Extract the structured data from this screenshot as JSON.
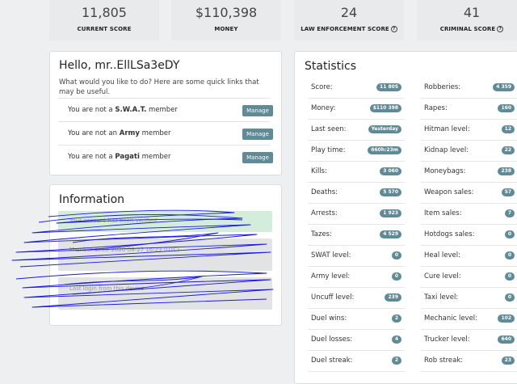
{
  "stats": [
    {
      "value": "11,805",
      "label": "CURRENT SCORE",
      "help": false
    },
    {
      "value": "$110,398",
      "label": "MONEY",
      "help": false
    },
    {
      "value": "24",
      "label": "LAW ENFORCEMENT SCORE",
      "help": true
    },
    {
      "value": "41",
      "label": "CRIMINAL SCORE",
      "help": true
    }
  ],
  "welcome": {
    "title": "Hello, mr..EllLSa3eDY",
    "intro": "What would you like to do? Here are some quick links that may be useful.",
    "groups": [
      {
        "prefix": "You are not a ",
        "name": "S.W.A.T.",
        "suffix": " member",
        "button": "Manage"
      },
      {
        "prefix": "You are not an ",
        "name": "Army",
        "suffix": " member",
        "button": "Manage"
      },
      {
        "prefix": "You are not a ",
        "name": "Pagati",
        "suffix": " member",
        "button": "Manage"
      }
    ]
  },
  "information": {
    "title": "Information",
    "boxes": [
      {
        "text": "Your account has been verified",
        "color": "#d4edda"
      },
      {
        "text": "Member since 2020-08-27 16:23 (UTC)",
        "color": "#e2e3e5"
      },
      {
        "text": "Last login from this device",
        "color": "#e2e3e5"
      }
    ]
  },
  "statistics": {
    "title": "Statistics",
    "left": [
      {
        "k": "Score:",
        "v": "11 805"
      },
      {
        "k": "Money:",
        "v": "$110 398"
      },
      {
        "k": "Last seen:",
        "v": "Yesterday"
      },
      {
        "k": "Play time:",
        "v": "660h:23m"
      },
      {
        "k": "Kills:",
        "v": "3 060"
      },
      {
        "k": "Deaths:",
        "v": "5 570"
      },
      {
        "k": "Arrests:",
        "v": "1 923"
      },
      {
        "k": "Tazes:",
        "v": "4 529"
      },
      {
        "k": "SWAT level:",
        "v": "0"
      },
      {
        "k": "Army level:",
        "v": "0"
      },
      {
        "k": "Uncuff level:",
        "v": "239"
      },
      {
        "k": "Duel wins:",
        "v": "2"
      },
      {
        "k": "Duel losses:",
        "v": "4"
      },
      {
        "k": "Duel streak:",
        "v": "2"
      }
    ],
    "right": [
      {
        "k": "Robberies:",
        "v": "4 359"
      },
      {
        "k": "Rapes:",
        "v": "160"
      },
      {
        "k": "Hitman level:",
        "v": "12"
      },
      {
        "k": "Kidnap level:",
        "v": "22"
      },
      {
        "k": "Moneybags:",
        "v": "238"
      },
      {
        "k": "Weapon sales:",
        "v": "57"
      },
      {
        "k": "Item sales:",
        "v": "7"
      },
      {
        "k": "Hotdogs sales:",
        "v": "0"
      },
      {
        "k": "Heal level:",
        "v": "0"
      },
      {
        "k": "Cure level:",
        "v": "0"
      },
      {
        "k": "Taxi level:",
        "v": "0"
      },
      {
        "k": "Mechanic level:",
        "v": "102"
      },
      {
        "k": "Trucker level:",
        "v": "640"
      },
      {
        "k": "Rob streak:",
        "v": "23"
      }
    ]
  },
  "colors": {
    "accent": "#5f8a96",
    "scribble": "#1a1adf"
  }
}
